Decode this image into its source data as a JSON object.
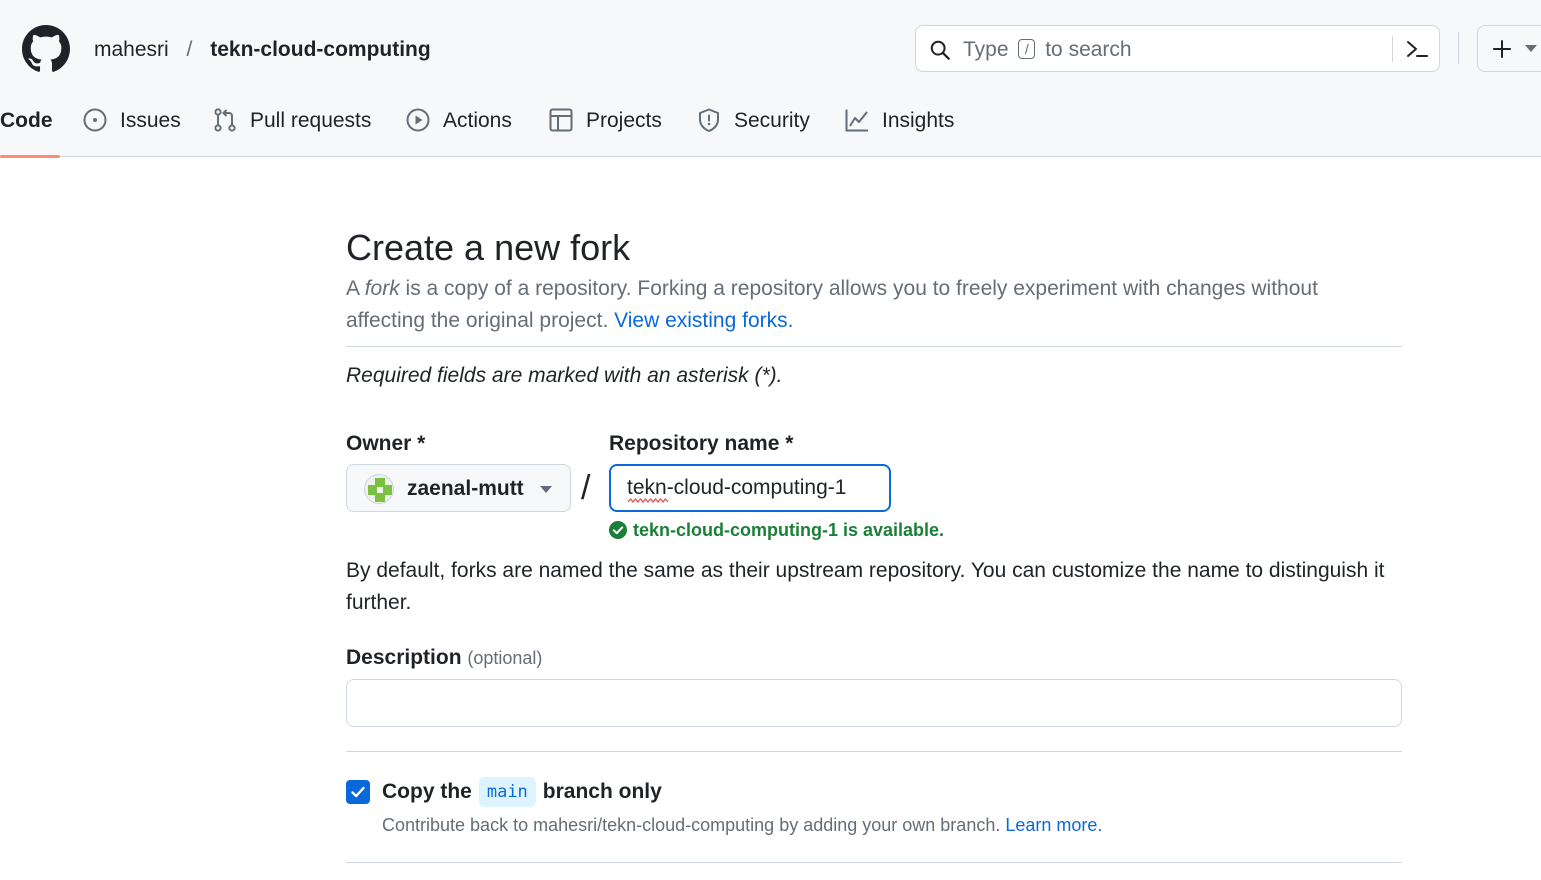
{
  "header": {
    "owner": "mahesri",
    "separator": "/",
    "repo": "tekn-cloud-computing",
    "search": {
      "prefix": "Type",
      "key": "/",
      "suffix": "to search"
    }
  },
  "tabs": [
    {
      "label": "Code",
      "icon": "code-icon",
      "active": true
    },
    {
      "label": "Issues",
      "icon": "issue-opened-icon"
    },
    {
      "label": "Pull requests",
      "icon": "git-pull-request-icon"
    },
    {
      "label": "Actions",
      "icon": "play-icon"
    },
    {
      "label": "Projects",
      "icon": "table-icon"
    },
    {
      "label": "Security",
      "icon": "shield-icon"
    },
    {
      "label": "Insights",
      "icon": "graph-icon"
    }
  ],
  "form": {
    "title": "Create a new fork",
    "subtitle_a": "A ",
    "subtitle_em": "fork",
    "subtitle_b": " is a copy of a repository. Forking a repository allows you to freely experiment with changes without affecting the original project. ",
    "subtitle_link": "View existing forks.",
    "required_note": "Required fields are marked with an asterisk (*).",
    "owner_label": "Owner *",
    "owner_value": "zaenal-mutt",
    "slash": "/",
    "repo_label": "Repository name *",
    "repo_value": "tekn-cloud-computing-1",
    "availability": "tekn-cloud-computing-1 is available.",
    "helper": "By default, forks are named the same as their upstream repository. You can customize the name to distinguish it further.",
    "description_label": "Description",
    "description_optional": "(optional)",
    "description_value": "",
    "copy_checked": true,
    "copy_prefix": "Copy the",
    "copy_branch": "main",
    "copy_suffix": "branch only",
    "copy_help": "Contribute back to mahesri/tekn-cloud-computing by adding your own branch.",
    "copy_help_link": "Learn more."
  },
  "colors": {
    "accent": "#0969da",
    "success": "#1a7f37",
    "active_tab_underline": "#fd8c73",
    "header_bg": "#f6f8fa",
    "border": "#d0d7de"
  }
}
